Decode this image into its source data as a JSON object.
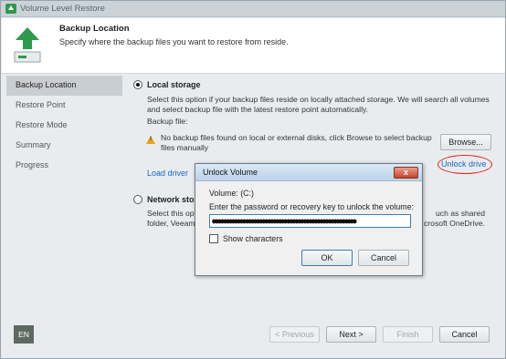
{
  "window": {
    "title": "Volume Level Restore"
  },
  "header": {
    "title": "Backup Location",
    "subtitle": "Specify where the backup files you want to restore from reside.",
    "icon": "green-up-arrow-disk-icon"
  },
  "sidebar": {
    "items": [
      {
        "label": "Backup Location",
        "active": true
      },
      {
        "label": "Restore Point",
        "active": false
      },
      {
        "label": "Restore Mode",
        "active": false
      },
      {
        "label": "Summary",
        "active": false
      },
      {
        "label": "Progress",
        "active": false
      }
    ]
  },
  "local_storage": {
    "label": "Local storage",
    "selected": true,
    "description_line1": "Select this option if your backup files reside on locally attached storage. We will search all volumes",
    "description_line2": "and select backup file with the latest restore point automatically.",
    "backup_file_label": "Backup file:",
    "warning_line1": "No backup files found on local or external disks, click Browse to select backup",
    "warning_line2": "files manually",
    "browse_button": "Browse...",
    "unlock_drive_link": "Unlock drive",
    "load_driver_link": "Load driver"
  },
  "network_storage": {
    "label": "Network storage",
    "selected": false,
    "line1_left": "Select this opti",
    "line1_right": "uch as shared",
    "line2_left": "folder, Veeam B",
    "line2_right": "crosoft OneDrive."
  },
  "footer": {
    "language": "EN",
    "previous_button": "< Previous",
    "next_button": "Next >",
    "finish_button": "Finish",
    "cancel_button": "Cancel"
  },
  "dialog": {
    "title": "Unlock Volume",
    "close_glyph": "x",
    "volume_label": "Volume: (C:)",
    "prompt": "Enter the password or recovery key to unlock the volume:",
    "password_value": "●●●●●●●●●●●●●●●●●●●●●●●●●●●●●●●●●●●●●●●●●●●●●●●●●●●●",
    "show_characters_label": "Show characters",
    "show_characters_checked": false,
    "ok_button": "OK",
    "cancel_button": "Cancel"
  },
  "colors": {
    "link": "#1b66c9",
    "highlight_ring": "#e0201c",
    "header_icon_green": "#2d9a4b",
    "sidebar_active": "#c9ced3"
  }
}
